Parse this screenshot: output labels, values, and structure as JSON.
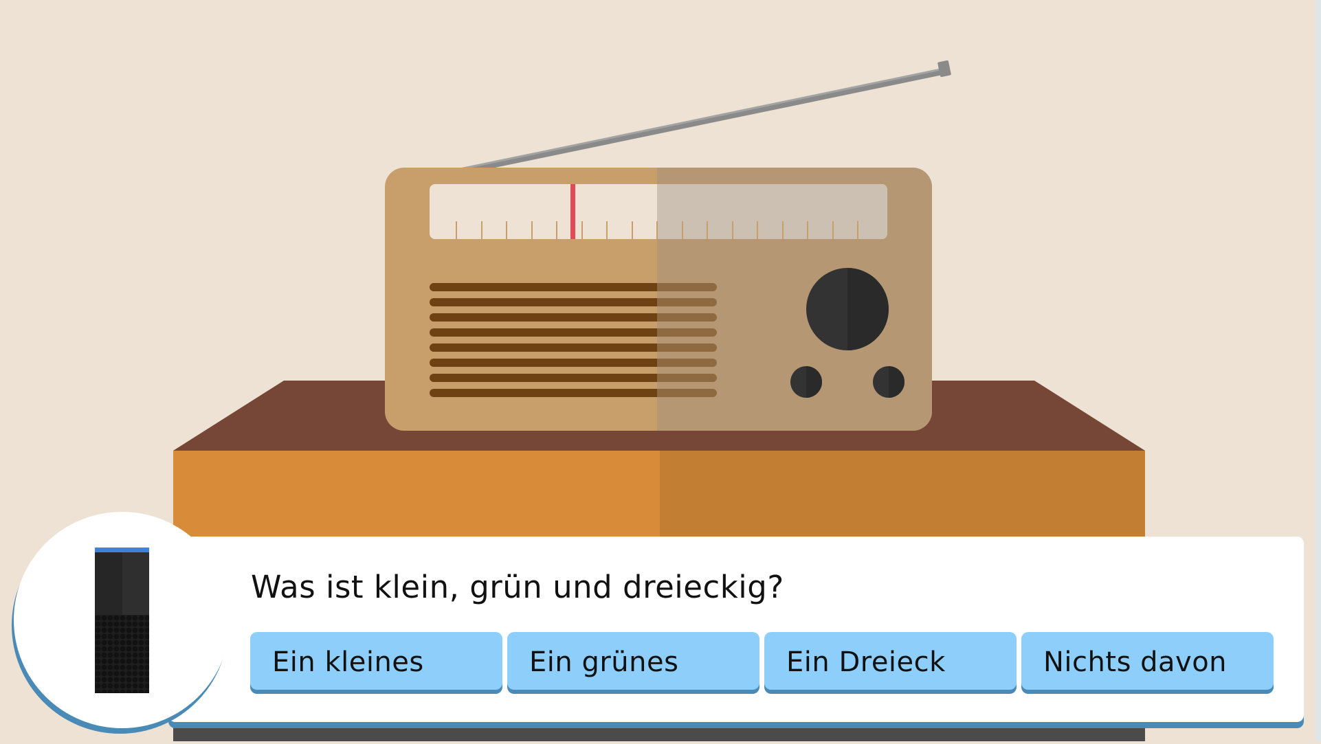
{
  "question": {
    "text": "Was ist klein, grün und dreieckig?"
  },
  "answers": [
    {
      "label": "Ein kleines"
    },
    {
      "label": "Ein grünes"
    },
    {
      "label": "Ein Dreieck"
    },
    {
      "label": "Nichts davon"
    }
  ],
  "colors": {
    "background": "#ede2d3",
    "radio_body": "#c89f6a",
    "radio_body_shaded": "#b59873",
    "dial_needle": "#df4b57",
    "table_top": "#764636",
    "table_front": "#d88b39",
    "button": "#8dcffa",
    "button_shadow": "#4a8ab7",
    "device_ring": "#3f83d6"
  },
  "icons": {
    "speaker_device": "echo-speaker-icon"
  }
}
